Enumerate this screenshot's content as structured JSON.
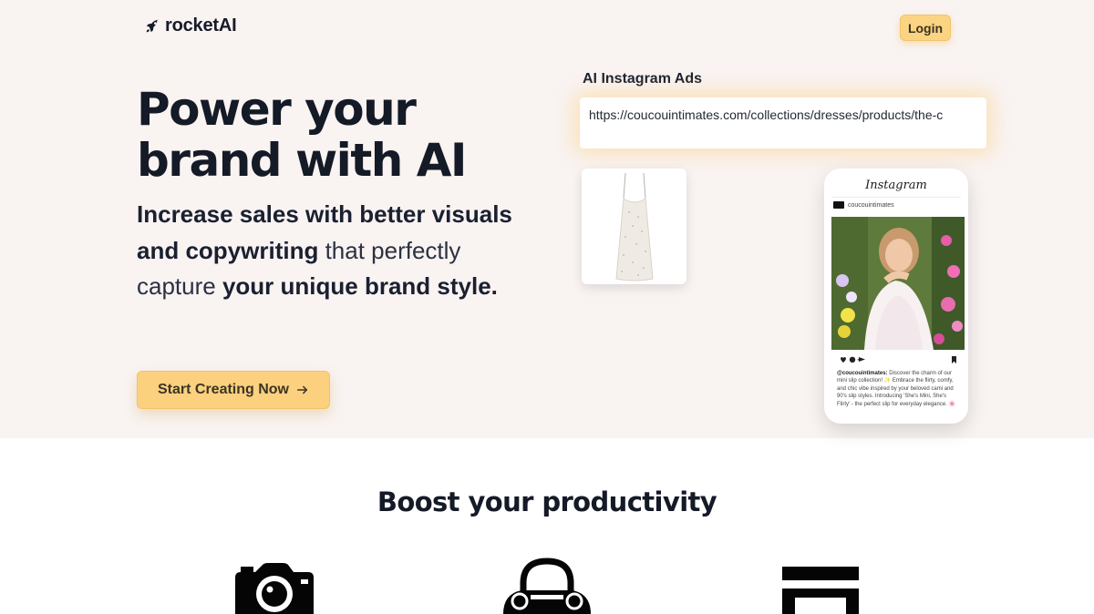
{
  "nav": {
    "logo_text": "rocketAI",
    "logo_icon": "rocket-icon",
    "login_label": "Login"
  },
  "hero": {
    "headline": "Power your brand with AI",
    "subhead": {
      "part1": "Increase sales with better visuals and copywriting",
      "part2": " that perfectly capture ",
      "part3": "your unique brand style."
    },
    "cta_label": "Start Creating Now",
    "cta_icon": "arrow-right-icon"
  },
  "demo": {
    "label": "AI Instagram Ads",
    "url_value": "https://coucouintimates.com/collections/dresses/products/the-c",
    "product_image": "slip-dress-product-photo",
    "instagram": {
      "brand": "Instagram",
      "username": "coucouintimates",
      "photo": "woman-in-floral-slip-dress-photo",
      "caption_user": "@coucouintimates:",
      "caption_text": " Discover the charm of our mini slip collection! ✨ Embrace the flirty, comfy, and chic vibe inspired by your beloved cami and 90's slip styles. Introducing 'She's Mini, She's Flirty' - the perfect slip for everyday elegance. 🌸"
    }
  },
  "features": {
    "title": "Boost your productivity",
    "icons": [
      "camera-icon",
      "shopping-bag-icon",
      "document-icon"
    ]
  },
  "colors": {
    "hero_bg": "#f9f3f2",
    "accent": "#fbd180",
    "text_dark": "#141a26"
  }
}
